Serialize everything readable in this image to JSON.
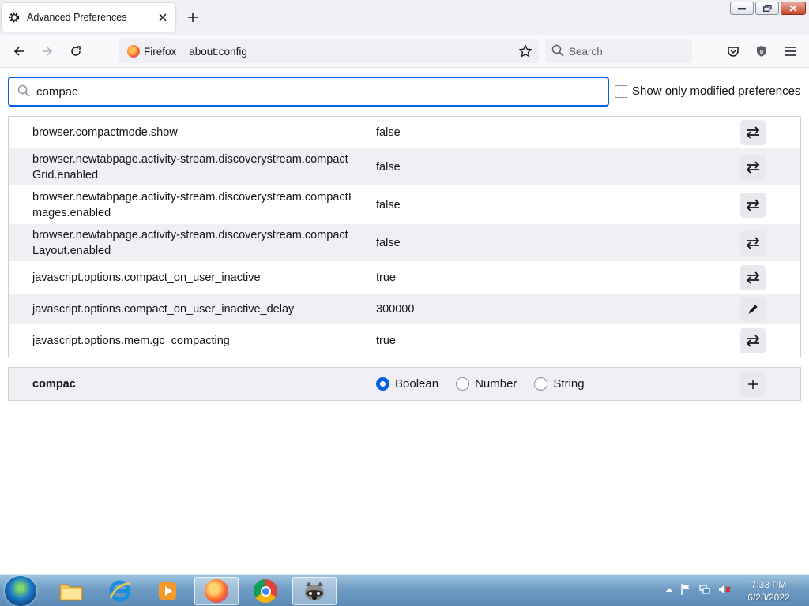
{
  "tab": {
    "title": "Advanced Preferences",
    "icon": "gear-icon"
  },
  "window_controls": [
    "minimize",
    "restore",
    "close"
  ],
  "navbar": {
    "identity_label": "Firefox",
    "url": "about:config",
    "search_placeholder": "Search"
  },
  "filter": {
    "value": "compac",
    "modified_only_label": "Show only modified preferences",
    "modified_only_checked": false
  },
  "prefs": [
    {
      "name": "browser.compactmode.show",
      "value": "false",
      "action": "toggle"
    },
    {
      "name": "browser.newtabpage.activity-stream.discoverystream.compactGrid.enabled",
      "value": "false",
      "action": "toggle"
    },
    {
      "name": "browser.newtabpage.activity-stream.discoverystream.compactImages.enabled",
      "value": "false",
      "action": "toggle"
    },
    {
      "name": "browser.newtabpage.activity-stream.discoverystream.compactLayout.enabled",
      "value": "false",
      "action": "toggle"
    },
    {
      "name": "javascript.options.compact_on_user_inactive",
      "value": "true",
      "action": "toggle"
    },
    {
      "name": "javascript.options.compact_on_user_inactive_delay",
      "value": "300000",
      "action": "edit"
    },
    {
      "name": "javascript.options.mem.gc_compacting",
      "value": "true",
      "action": "toggle"
    }
  ],
  "add_row": {
    "name": "compac",
    "types": [
      "Boolean",
      "Number",
      "String"
    ],
    "selected_type": "Boolean"
  },
  "taskbar": {
    "time": "7:33 PM",
    "date": "6/28/2022"
  },
  "colors": {
    "accent": "#0061e0",
    "row_alt": "#f0f0f4"
  }
}
